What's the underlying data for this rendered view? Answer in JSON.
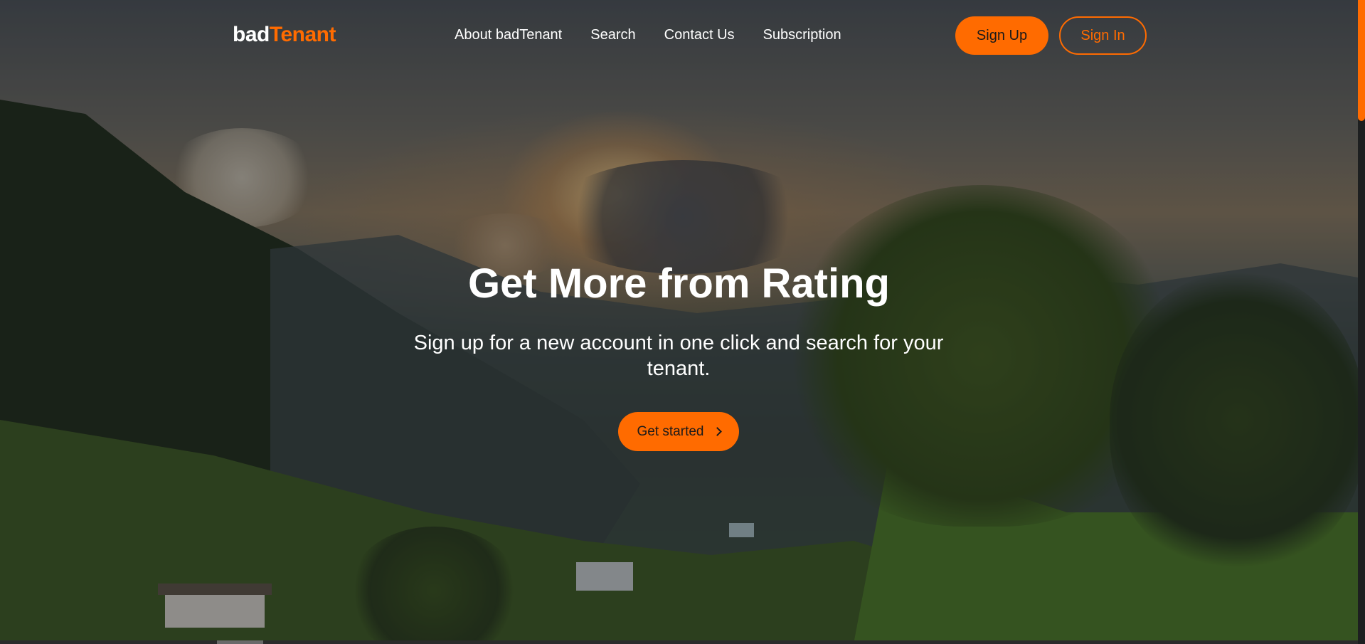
{
  "brand": {
    "part1": "bad",
    "part2": "Tenant",
    "accent_color": "#ff6b00"
  },
  "nav": {
    "items": [
      {
        "label": "About badTenant"
      },
      {
        "label": "Search"
      },
      {
        "label": "Contact Us"
      },
      {
        "label": "Subscription"
      }
    ]
  },
  "auth": {
    "signup_label": "Sign Up",
    "signin_label": "Sign In"
  },
  "hero": {
    "title": "Get More from Rating",
    "subtitle": "Sign up for a new account in one click and search for your tenant.",
    "cta_label": "Get started",
    "cta_icon": "chevron-right-icon",
    "background": "mountain-landscape-sunset"
  }
}
